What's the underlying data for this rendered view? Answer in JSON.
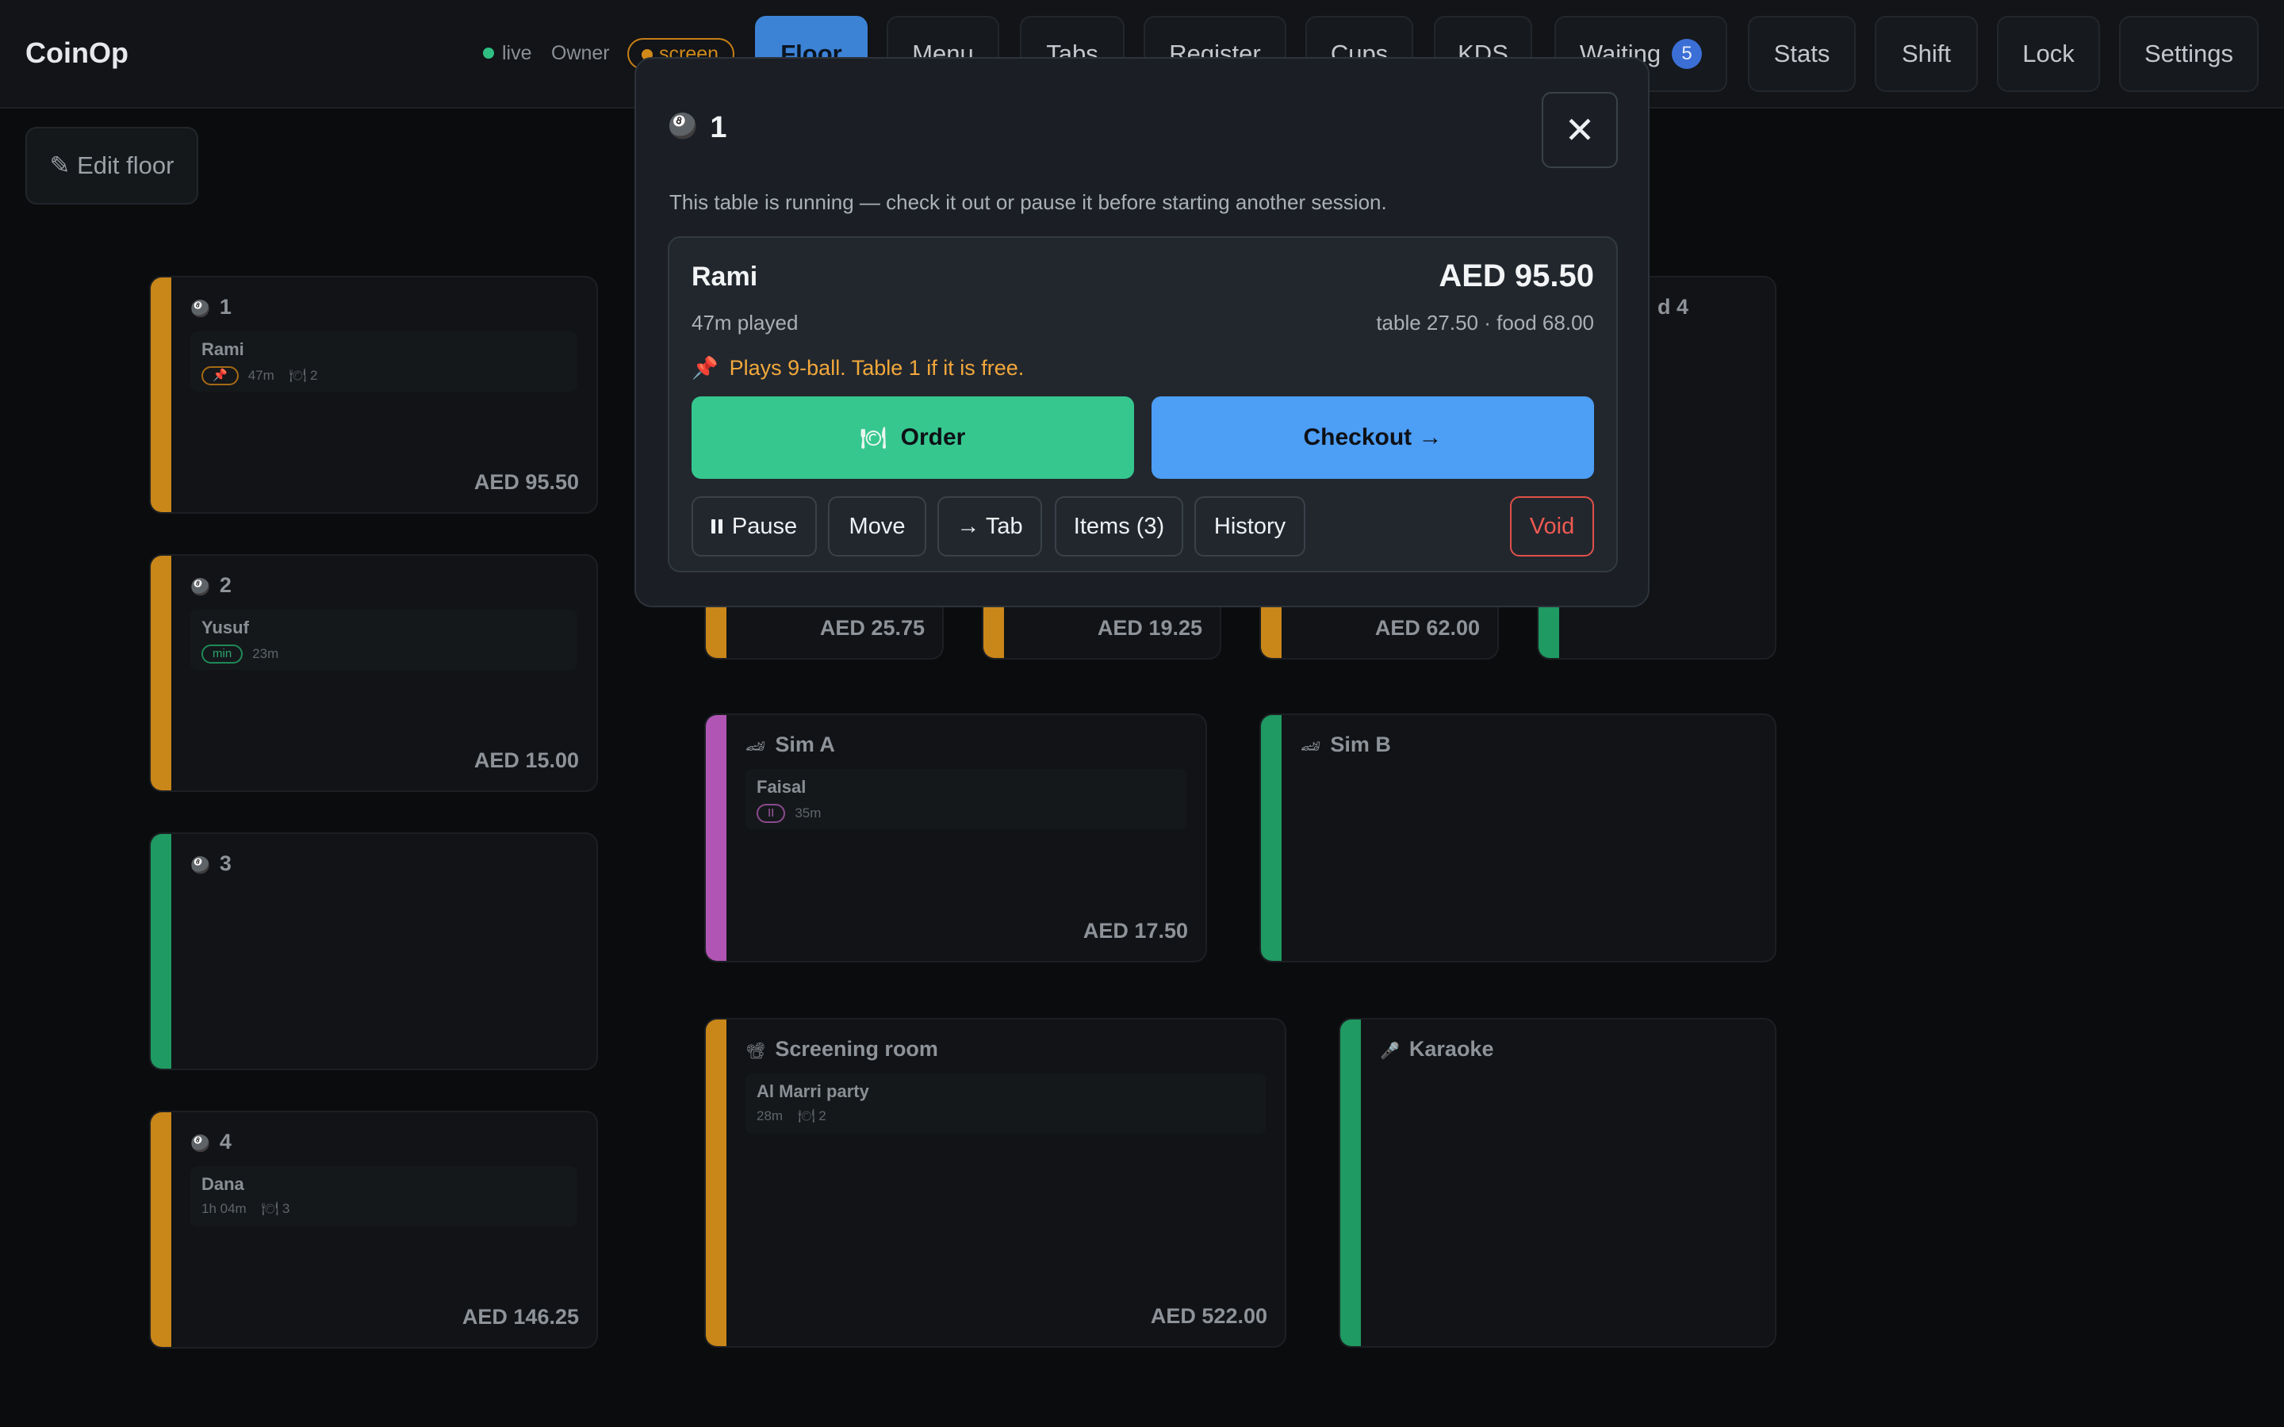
{
  "app": {
    "brand": "CoinOp"
  },
  "status": {
    "live_label": "live",
    "role": "Owner",
    "screen_label": "screen"
  },
  "nav": {
    "floor": "Floor",
    "menu": "Menu",
    "tabs": "Tabs",
    "register": "Register",
    "cups": "Cups",
    "kds": "KDS",
    "waiting": "Waiting",
    "waiting_count": "5",
    "stats": "Stats",
    "shift": "Shift",
    "lock": "Lock",
    "settings": "Settings"
  },
  "floor": {
    "edit_label": "✎ Edit floor",
    "cards": {
      "t1": {
        "icon": "pool-ball-icon",
        "name": "1",
        "session": "Rami",
        "pill": "📌",
        "time": "47m",
        "items": "🍽 2",
        "amount": "AED 95.50",
        "color": "orange"
      },
      "t2": {
        "icon": "pool-ball-icon",
        "name": "2",
        "session": "Yusuf",
        "pill": "min",
        "time": "23m",
        "amount": "AED 15.00",
        "color": "orange"
      },
      "t3": {
        "icon": "pool-ball-icon",
        "name": "3",
        "color": "green"
      },
      "t4": {
        "icon": "pool-ball-icon",
        "name": "4",
        "session": "Dana",
        "time": "1h 04m",
        "items": "🍽 3",
        "amount": "AED 146.25",
        "color": "orange"
      },
      "b1": {
        "amount": "AED 25.75",
        "color": "orange"
      },
      "b2": {
        "amount": "AED 19.25",
        "color": "orange"
      },
      "b3": {
        "amount": "AED 62.00",
        "color": "orange"
      },
      "b4": {
        "name_fragment": "d 4",
        "color": "green"
      },
      "simA": {
        "icon": "race-car-icon",
        "name": "Sim A",
        "session": "Faisal",
        "pill": "II",
        "time": "35m",
        "amount": "AED 17.50",
        "color": "purple"
      },
      "simB": {
        "icon": "race-car-icon",
        "name": "Sim B",
        "color": "green"
      },
      "screening": {
        "icon": "film-camera-icon",
        "name": "Screening room",
        "session": "Al Marri party",
        "time": "28m",
        "items": "🍽 2",
        "amount": "AED 522.00",
        "color": "orange"
      },
      "karaoke": {
        "icon": "microphone-icon",
        "name": "Karaoke",
        "color": "green"
      }
    }
  },
  "modal": {
    "title": "1",
    "description": "This table is running — check it out or pause it before starting another session.",
    "customer": "Rami",
    "total": "AED 95.50",
    "played": "47m played",
    "breakdown": "table 27.50 · food 68.00",
    "note": "Plays 9-ball. Table 1 if it is free.",
    "order_label": "Order",
    "checkout_label": "Checkout →",
    "pause_label": "Pause",
    "move_label": "Move",
    "tab_label": "→ Tab",
    "items_label": "Items (3)",
    "history_label": "History",
    "void_label": "Void"
  },
  "colors": {
    "orange": "#c98619",
    "green": "#1f9a62",
    "purple": "#b155b4",
    "order": "#36c78f",
    "checkout": "#4d9ef5",
    "void": "#ef5a52"
  }
}
